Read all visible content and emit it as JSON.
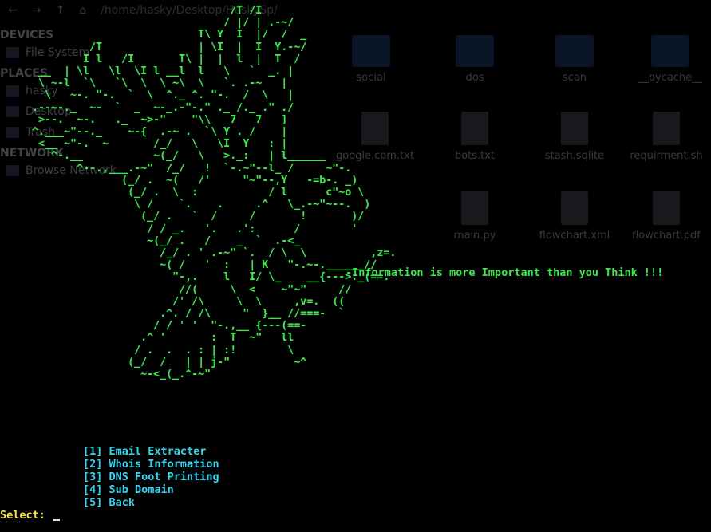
{
  "background_window": {
    "path": "/home/hasky/Desktop/HaskySp/",
    "sidebar": {
      "sections": [
        {
          "title": "DEVICES",
          "items": [
            "File System"
          ]
        },
        {
          "title": "PLACES",
          "items": [
            "hasky",
            "Desktop",
            "Trash"
          ]
        },
        {
          "title": "NETWORK",
          "items": [
            "Browse Network"
          ]
        }
      ]
    },
    "files": [
      {
        "name": "social"
      },
      {
        "name": "dos"
      },
      {
        "name": "scan"
      },
      {
        "name": "__pycache__"
      },
      {
        "name": "google.com.txt"
      },
      {
        "name": "bots.txt"
      },
      {
        "name": "stash.sqlite"
      },
      {
        "name": "requirment.sh"
      },
      {
        "name": "main.py"
      },
      {
        "name": "flowchart.xml"
      },
      {
        "name": "flowchart.pdf"
      }
    ]
  },
  "terminal": {
    "ascii_art": "                                   /T /I\n                                  / |/ | .-~/\n                              T\\ Y  I  |/  /  _\n             /T               | \\I  |  I  Y.-~/\n            I l   /I       T\\ |  |  l  |  T  /\n     __  | \\l   \\l  \\I l __l  l   \\   `  _. |\n     \\ ~-l  `\\   `\\  \\  \\ ~\\  \\   `. .-~   |\n      \\   ~-. \"-.  `  \\  ^._ ^. \"-.  /  \\   |\n    .--~-._  ~-  `  _  ~-_.-\"-.\" ._ /._ .\" ./\n     >--.  ~-.   ._  ~>-\"    \"\\\\   7   7   ]\n    ^.___~\"--._    ~-{  .-~ .  `\\ Y . /    |\n     <__ ~\"-.  ~       /_/   \\   \\I  Y   : |\n       ^-.__           ~(_/   \\   >._:   | l______\n           ^--.,___.-~\"  /_/   !  `-.~\"--l_ /     ~\"-.\n                  (_/ .  ~(   /'     \"~\"--,Y   -=b-. _)\n                   (_/ .  \\  :           / l      c\"~o \\\n                    \\ /    `.    .     .^   \\_.-~\"~--.  )\n                     (_/ .   `  /     /       !       )/\n                      / / _.   '.   .':      /        '\n                      ~(_/ .   /    _  `  .-<_\n                        /_/ . ' .-~\" `.  / \\  \\          ,z=.\n                        ~( /   '  :   | K   \"-.~-.______//\n                          \"-,.    l   I/ \\_    __{--->._(==.\n                           //(     \\  <    ~\"~\"     //\n                          /' /\\     \\  \\     ,v=.  ((\n                        .^. / /\\     \"  }__ //===-  `\n                       / / ' '  \"-.,__ {---(==-\n                     .^ '       :  T  ~\"   ll\n                    / .  .  . : | :!        \\\n                   (_/  /   | | j-\"          ~^\n                     ~-<_(_.^-~\"",
    "tagline": "-Information is more Important than you Think !!!",
    "menu": [
      "[1] Email Extracter",
      "[2] Whois Information",
      "[3] DNS Foot Printing",
      "[4] Sub Domain",
      "[5] Back"
    ],
    "prompt": "Select: "
  },
  "colors": {
    "background": "#000000",
    "art": "#3ee84d",
    "menu": "#38d5f0",
    "prompt": "#f6e84a"
  }
}
